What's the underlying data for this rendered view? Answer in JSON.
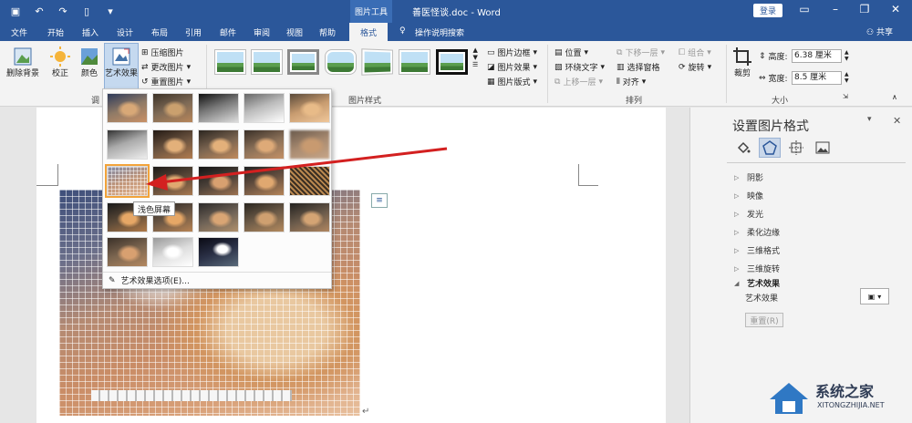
{
  "titlebar": {
    "doc_title": "善医怪谈.doc - Word",
    "context_group": "图片工具",
    "login": "登录",
    "share": "共享"
  },
  "tabs": [
    "文件",
    "开始",
    "插入",
    "设计",
    "布局",
    "引用",
    "邮件",
    "审阅",
    "视图",
    "帮助",
    "格式",
    "操作说明搜索"
  ],
  "active_tab": "格式",
  "ribbon": {
    "adjust": {
      "remove_bg": "删除背景",
      "correct": "校正",
      "color": "颜色",
      "artistic": "艺术效果",
      "compress": "压缩图片",
      "change": "更改图片",
      "reset": "重置图片",
      "group_label": "调"
    },
    "styles": {
      "border": "图片边框",
      "effects": "图片效果",
      "layout": "图片版式",
      "group_label": "图片样式"
    },
    "arrange": {
      "position": "位置",
      "wrap": "环绕文字",
      "forward": "上移一层",
      "backward": "下移一层",
      "selection_pane": "选择窗格",
      "align": "对齐",
      "group": "组合",
      "rotate": "旋转",
      "group_label": "排列"
    },
    "size": {
      "crop": "裁剪",
      "height_label": "高度:",
      "height_value": "6.38 厘米",
      "width_label": "宽度:",
      "width_value": "8.5 厘米",
      "group_label": "大小"
    }
  },
  "dropdown": {
    "tooltip": "浅色屏幕",
    "options": "艺术效果选项(E)..."
  },
  "pane": {
    "title": "设置图片格式",
    "sections": [
      "阴影",
      "映像",
      "发光",
      "柔化边缘",
      "三维格式",
      "三维旋转",
      "艺术效果"
    ],
    "expanded": "艺术效果",
    "prop_label": "艺术效果",
    "reset": "重置(R)"
  },
  "watermark": {
    "title": "系统之家",
    "url": "XITONGZHIJIA.NET"
  }
}
